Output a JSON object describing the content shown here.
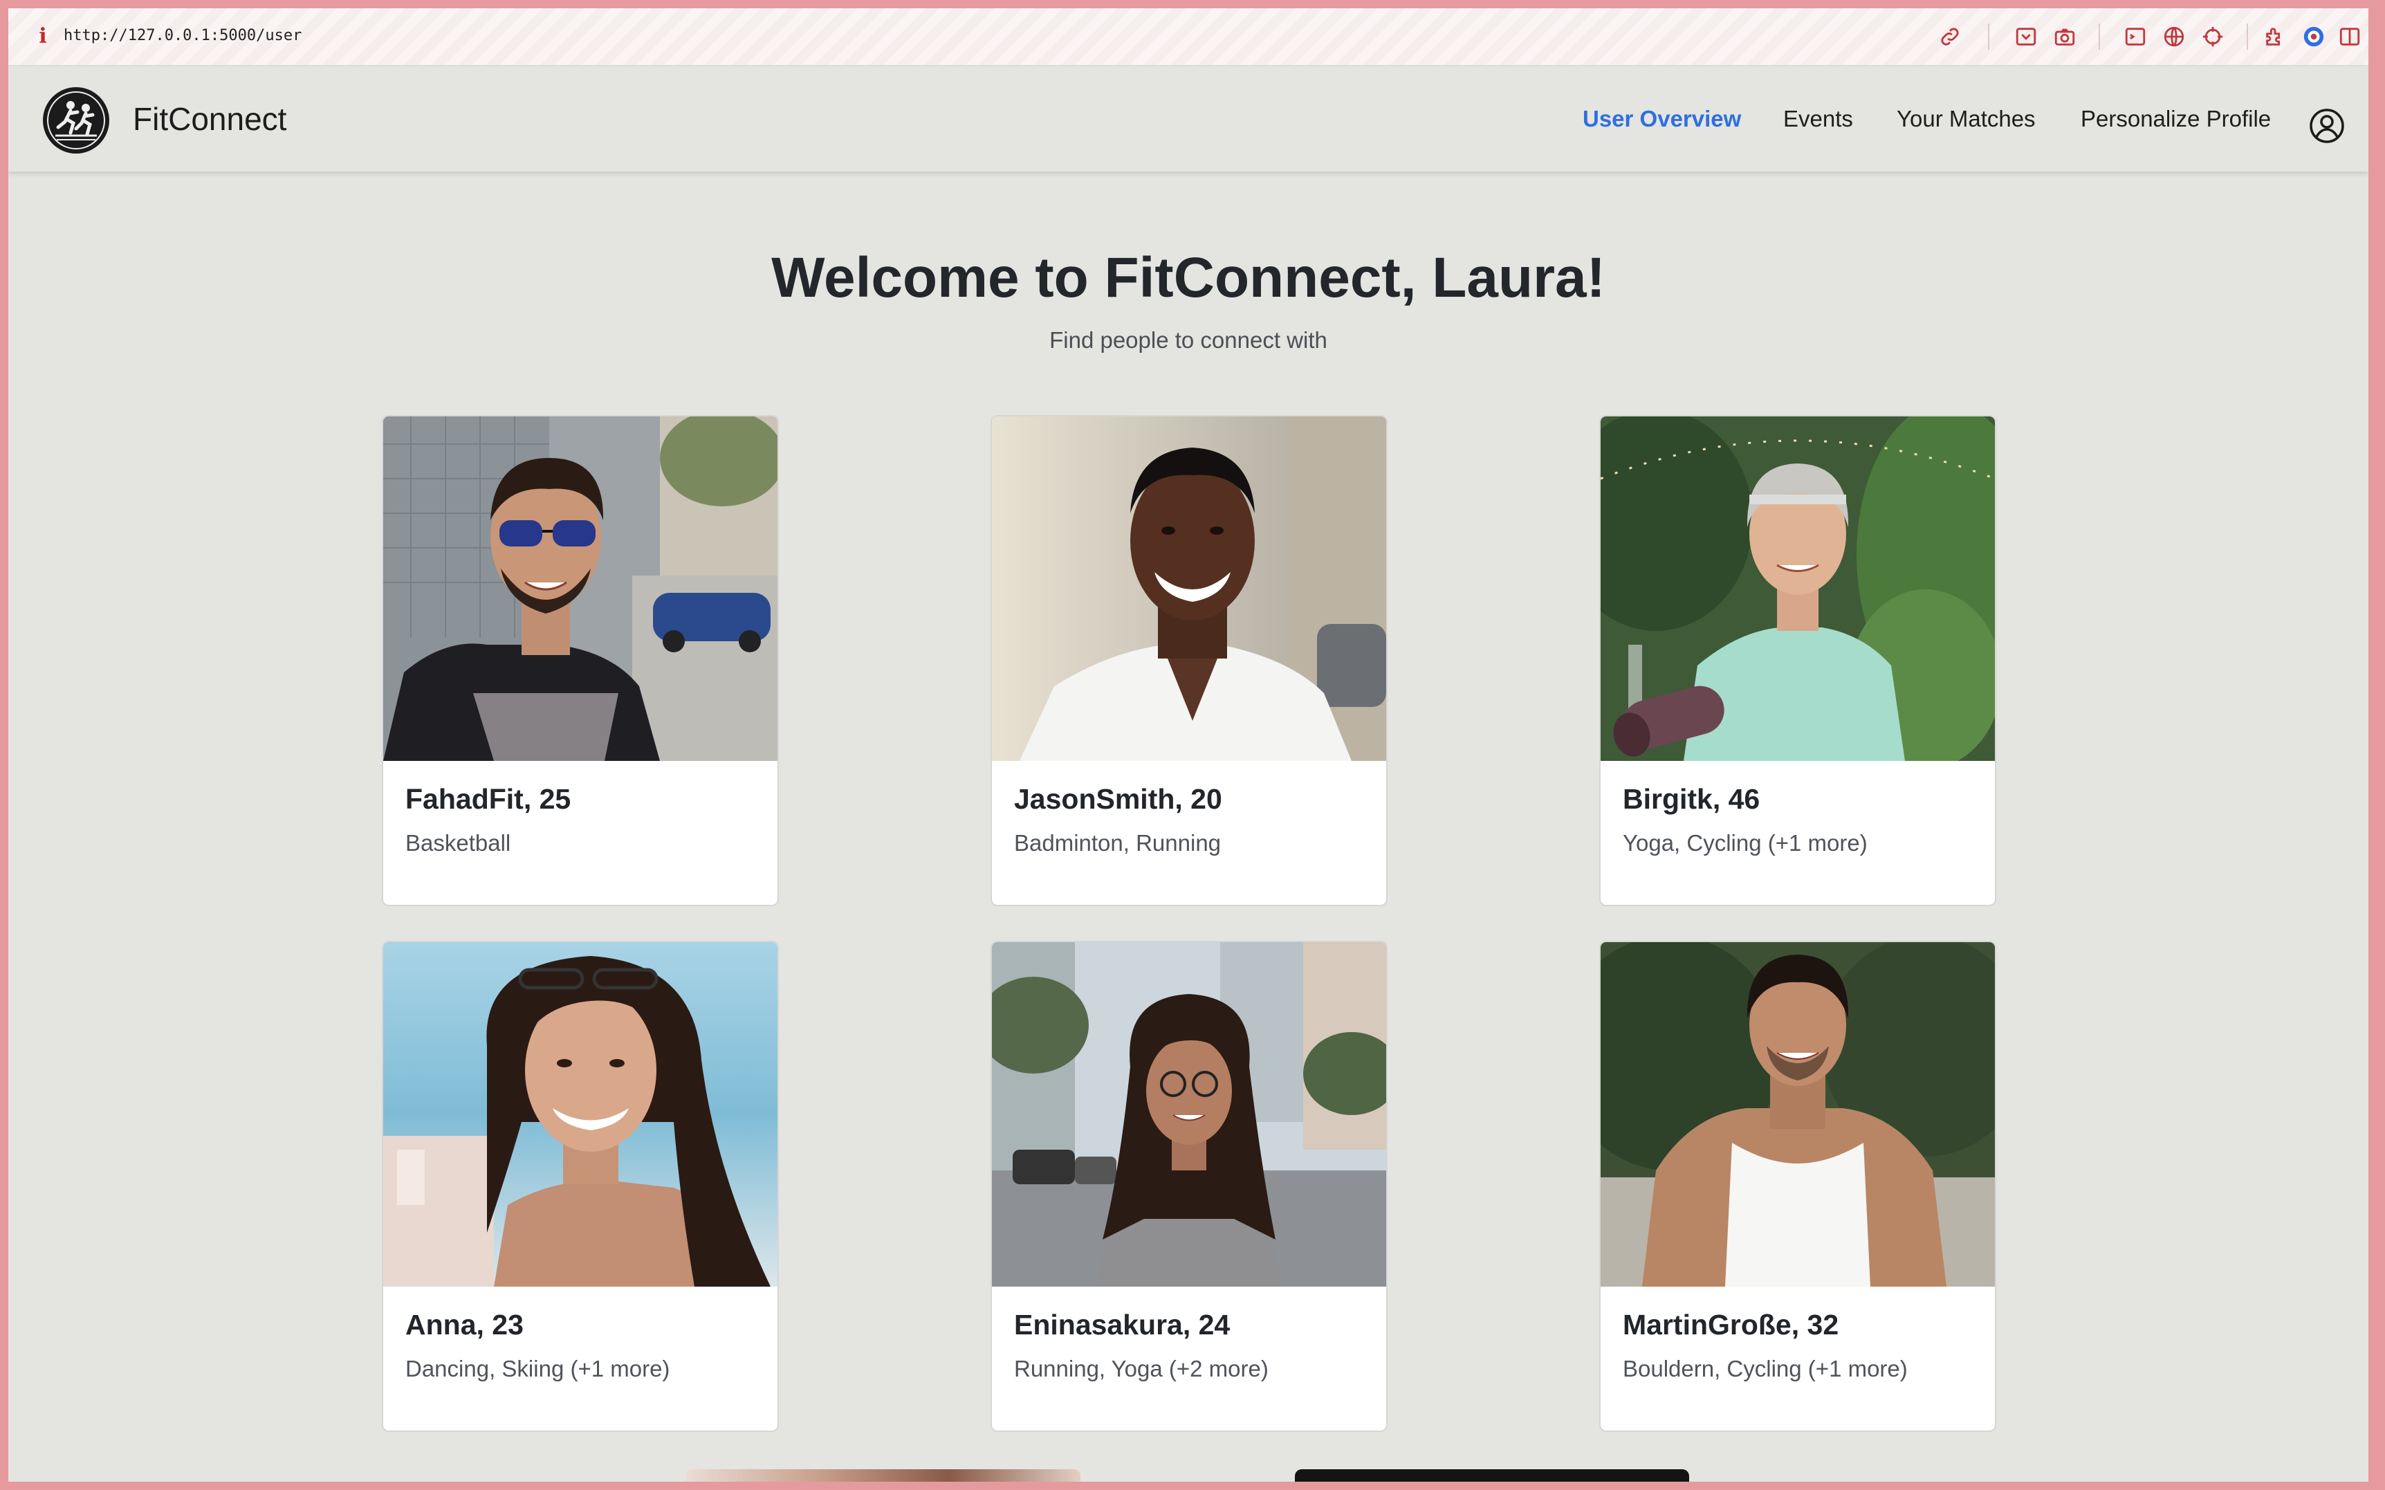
{
  "browser": {
    "url": "http://127.0.0.1:5000/user",
    "info_glyph": "i"
  },
  "nav": {
    "brand": "FitConnect",
    "links": [
      {
        "label": "User Overview",
        "active": true
      },
      {
        "label": "Events",
        "active": false
      },
      {
        "label": "Your Matches",
        "active": false
      },
      {
        "label": "Personalize Profile",
        "active": false
      }
    ],
    "active_color": "#2f6fdf"
  },
  "main": {
    "title": "Welcome to FitConnect, Laura!",
    "subtitle": "Find people to connect with"
  },
  "users": [
    {
      "name": "FahadFit, 25",
      "sports": "Basketball"
    },
    {
      "name": "JasonSmith, 20",
      "sports": "Badminton, Running"
    },
    {
      "name": "Birgitk, 46",
      "sports": "Yoga, Cycling (+1 more)"
    },
    {
      "name": "Anna, 23",
      "sports": "Dancing, Skiing (+1 more)"
    },
    {
      "name": "Eninasakura, 24",
      "sports": "Running, Yoga (+2 more)"
    },
    {
      "name": "MartinGroße, 32",
      "sports": "Bouldern, Cycling (+1 more)"
    }
  ]
}
